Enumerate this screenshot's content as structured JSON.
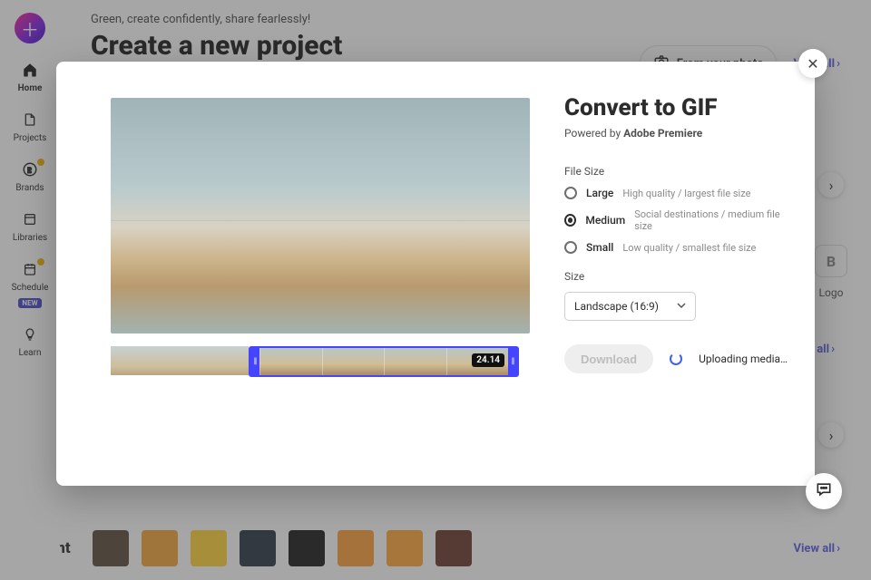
{
  "nav": {
    "items": [
      {
        "label": "Home",
        "icon": "home"
      },
      {
        "label": "Projects",
        "icon": "doc"
      },
      {
        "label": "Brands",
        "icon": "brand",
        "dot": true
      },
      {
        "label": "Libraries",
        "icon": "lib"
      },
      {
        "label": "Schedule",
        "icon": "cal",
        "badge": "NEW",
        "dot": true
      },
      {
        "label": "Learn",
        "icon": "bulb"
      }
    ]
  },
  "header": {
    "greeting": "Green, create confidently, share fearlessly!",
    "title": "Create a new project",
    "from_photo": "From your photo",
    "view_all": "View all"
  },
  "type_tile": {
    "label": "Logo",
    "glyph": "B"
  },
  "recent": {
    "title": "Recent",
    "view_all": "View all",
    "thumbs": [
      {
        "bg": "#5c4a3b"
      },
      {
        "bg": "#f4a53a"
      },
      {
        "bg": "#ffd23a"
      },
      {
        "bg": "#2a3744"
      },
      {
        "bg": "#1a1a1a"
      },
      {
        "bg": "#ff9f3a"
      },
      {
        "bg": "#ffa63a"
      },
      {
        "bg": "#6a3a2c"
      }
    ]
  },
  "dialog": {
    "title": "Convert to GIF",
    "powered_prefix": "Powered by ",
    "powered_brand": "Adobe Premiere",
    "filesize_label": "File Size",
    "options": [
      {
        "label": "Large",
        "hint": "High quality / largest file size",
        "selected": false
      },
      {
        "label": "Medium",
        "hint": "Social destinations / medium file size",
        "selected": true
      },
      {
        "label": "Small",
        "hint": "Low quality / smallest file size",
        "selected": false
      }
    ],
    "size_label": "Size",
    "size_value": "Landscape (16:9)",
    "download": "Download",
    "uploading": "Uploading media…",
    "timecode": "24.14"
  }
}
